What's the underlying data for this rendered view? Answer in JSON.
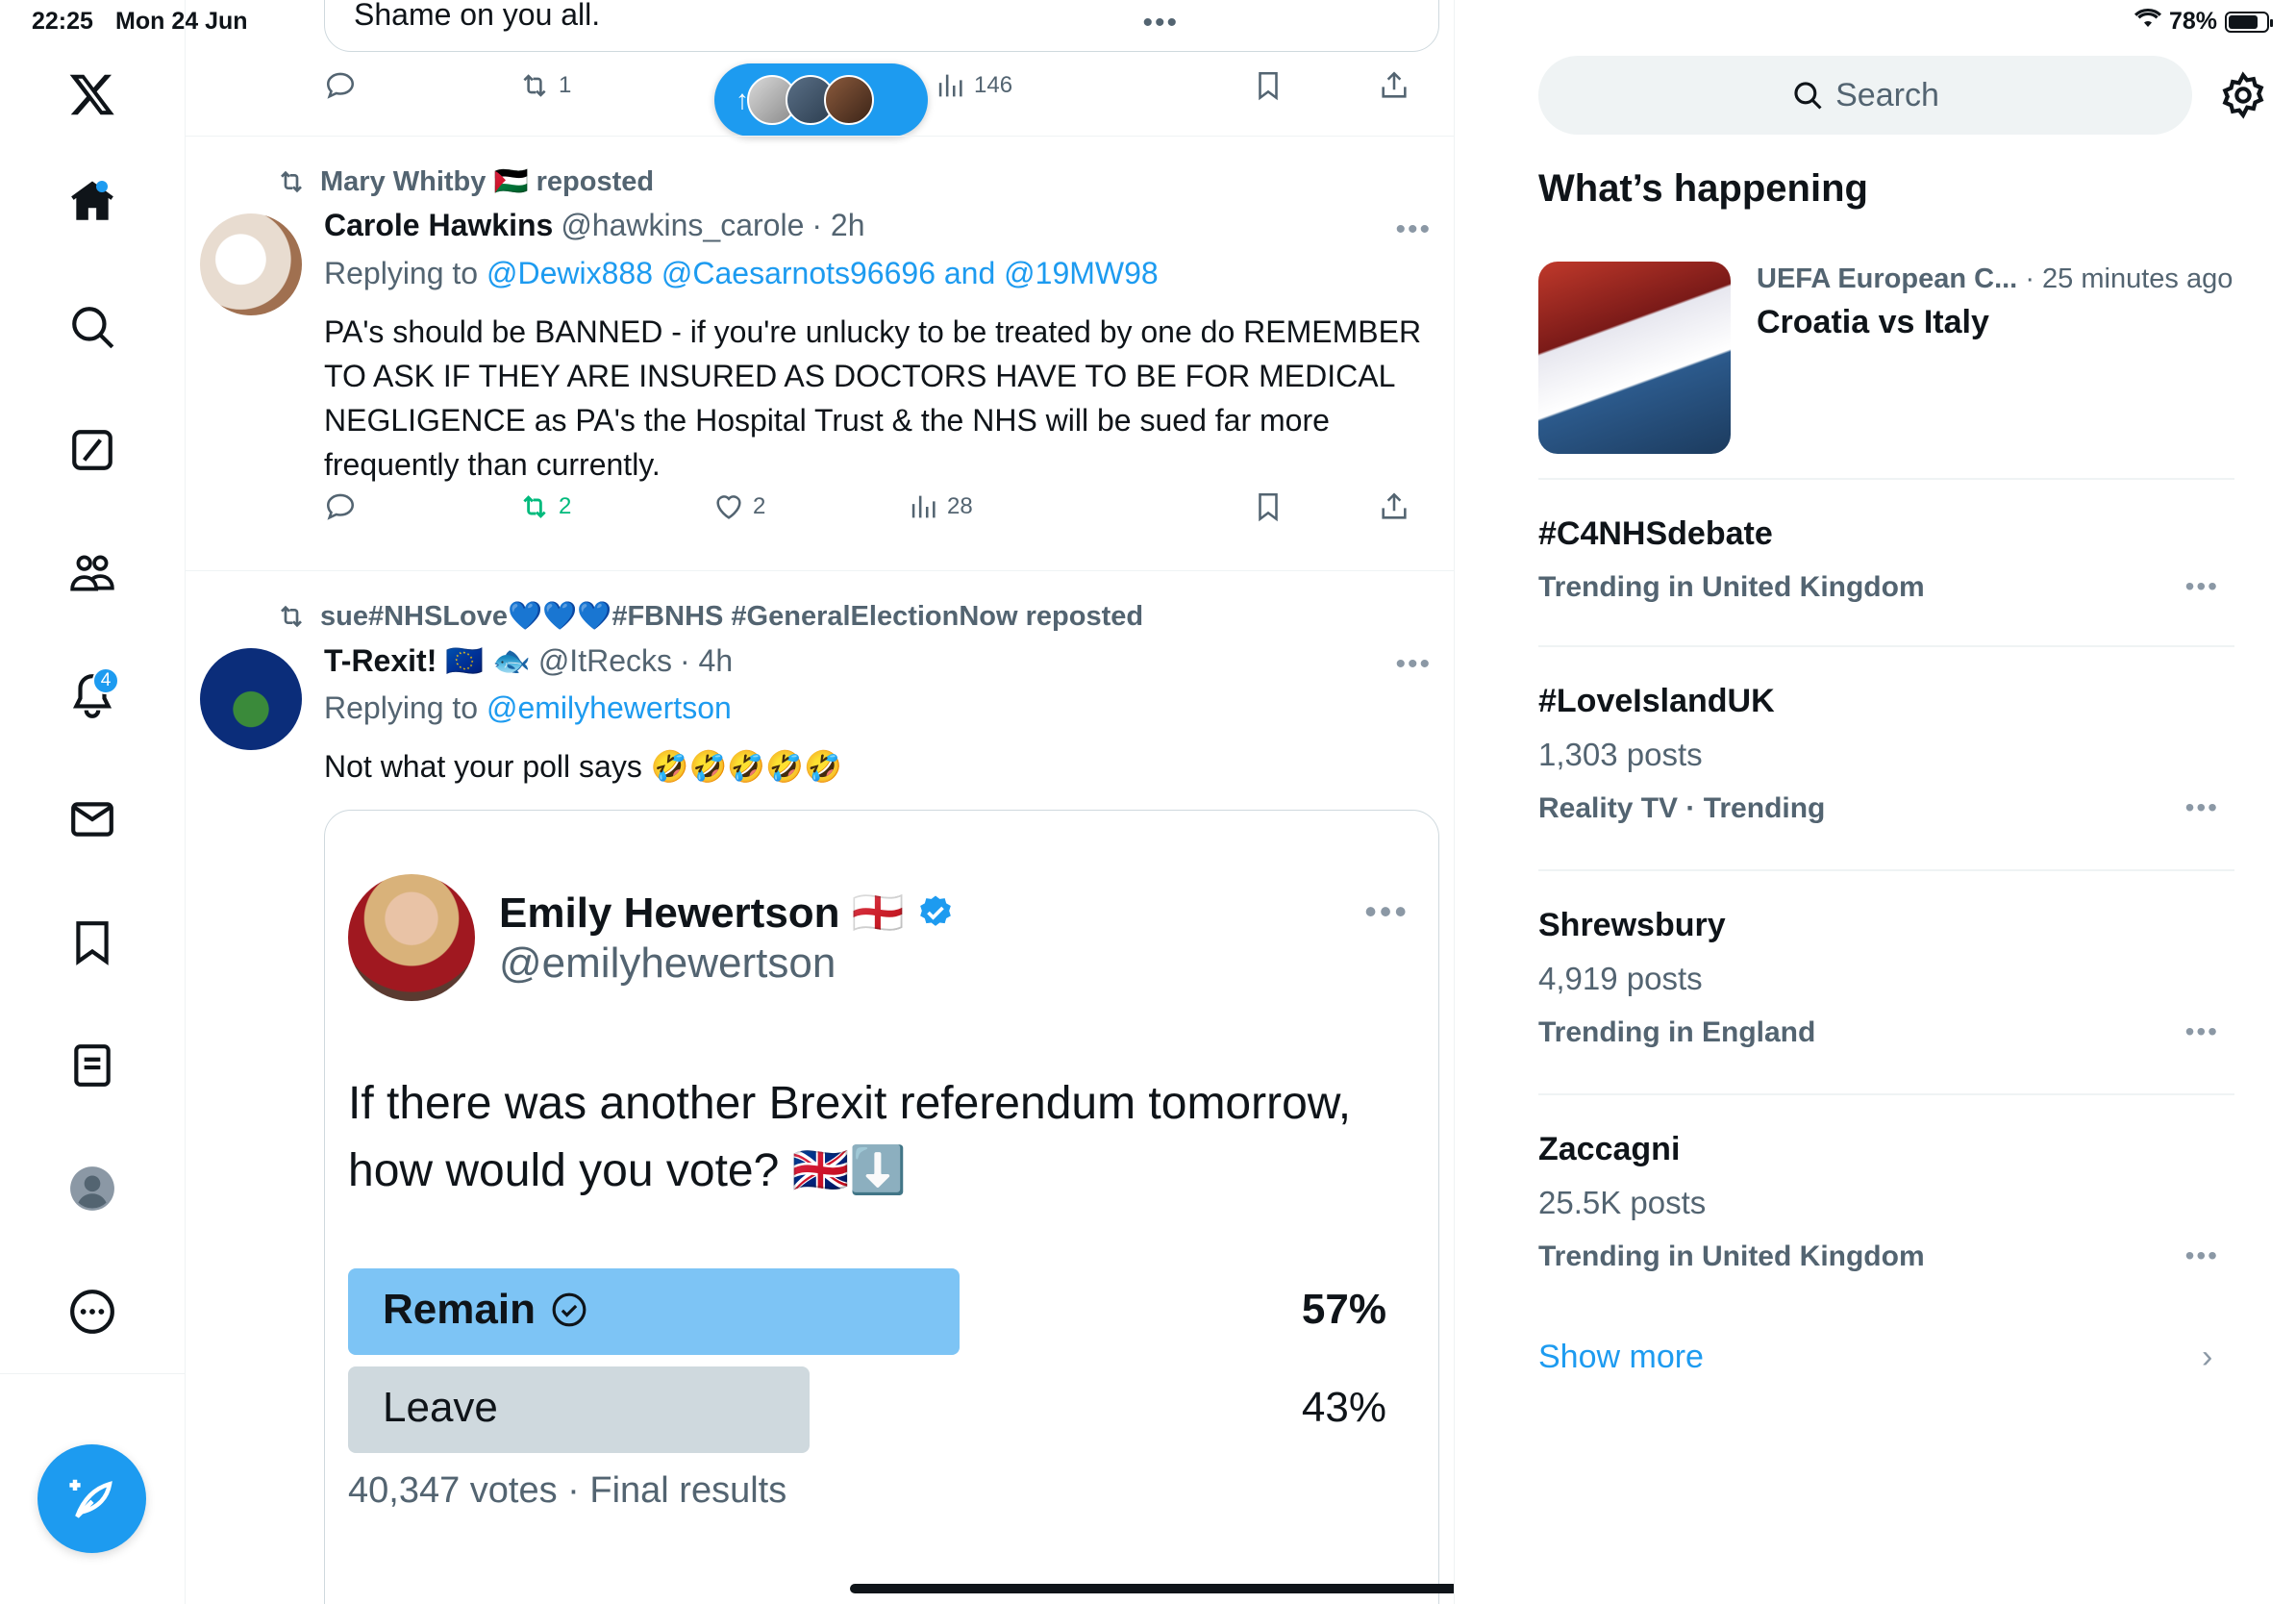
{
  "status_bar": {
    "time": "22:25",
    "date": "Mon 24 Jun",
    "battery": "78%"
  },
  "nav": {
    "notifications_badge": "4"
  },
  "feed": {
    "previous_tweet": {
      "text": "Shame on you all.",
      "retweets": "1",
      "views": "146"
    },
    "new_posts_pill": {
      "arrow": "↑"
    },
    "tweets": [
      {
        "reposted_by": "Mary Whitby 🇵🇸 reposted",
        "name": "Carole Hawkins",
        "handle": "@hawkins_carole",
        "time": "· 2h",
        "replying_label": "Replying to",
        "replying_to": "@Dewix888 @Caesarnots96696 and @19MW98",
        "text": "PA's should be BANNED - if you're unlucky to be treated by one do REMEMBER TO ASK IF THEY ARE INSURED AS DOCTORS HAVE TO BE FOR MEDICAL NEGLIGENCE as PA's the Hospital Trust &  the NHS will be sued far more frequently than currently.",
        "retweets": "2",
        "likes": "2",
        "views": "28"
      },
      {
        "reposted_by": "sue#NHSLove💙💙💙#FBNHS #GeneralElectionNow reposted",
        "name": "T-Rexit! 🇪🇺 🐟",
        "handle": "@ItRecks",
        "time": "· 4h",
        "replying_label": "Replying to",
        "replying_to": "@emilyhewertson",
        "text": "Not what your poll says 🤣🤣🤣🤣🤣",
        "quote": {
          "name": "Emily Hewertson 🏴󠁧󠁢󠁥󠁮󠁧󠁿",
          "handle": "@emilyhewertson",
          "text": "If there was another Brexit referendum tomorrow, how would you vote? 🇬🇧⬇️",
          "poll": {
            "options": [
              {
                "label": "Remain",
                "percent": "57%",
                "fraction": 0.57,
                "winner": true
              },
              {
                "label": "Leave",
                "percent": "43%",
                "fraction": 0.43,
                "winner": false
              }
            ],
            "footer": "40,347 votes · Final results"
          }
        }
      }
    ]
  },
  "sidebar": {
    "search_placeholder": "Search",
    "title": "What’s happening",
    "featured": {
      "category": "UEFA European C...",
      "time": "· 25 minutes ago",
      "title": "Croatia vs Italy"
    },
    "trends": [
      {
        "title": "#C4NHSdebate",
        "posts": "",
        "context": "Trending in United Kingdom"
      },
      {
        "title": "#LoveIslandUK",
        "posts": "1,303 posts",
        "context": "Reality TV · Trending"
      },
      {
        "title": "Shrewsbury",
        "posts": "4,919 posts",
        "context": "Trending in England"
      },
      {
        "title": "Zaccagni",
        "posts": "25.5K posts",
        "context": "Trending in United Kingdom"
      }
    ],
    "show_more": "Show more",
    "more_glyph": "•••"
  },
  "colors": {
    "accent": "#1d9bf0",
    "poll_winner": "#7dc4f5",
    "poll_other": "#cfd9de",
    "retweet_green": "#00ba7c"
  },
  "icons": [
    "x-logo-icon",
    "home-icon",
    "search-icon",
    "grok-icon",
    "communities-icon",
    "bell-icon",
    "mail-icon",
    "bookmark-icon",
    "lists-icon",
    "profile-icon",
    "more-icon",
    "compose-icon",
    "reply-icon",
    "retweet-icon",
    "like-icon",
    "views-icon",
    "share-icon",
    "gear-icon"
  ]
}
